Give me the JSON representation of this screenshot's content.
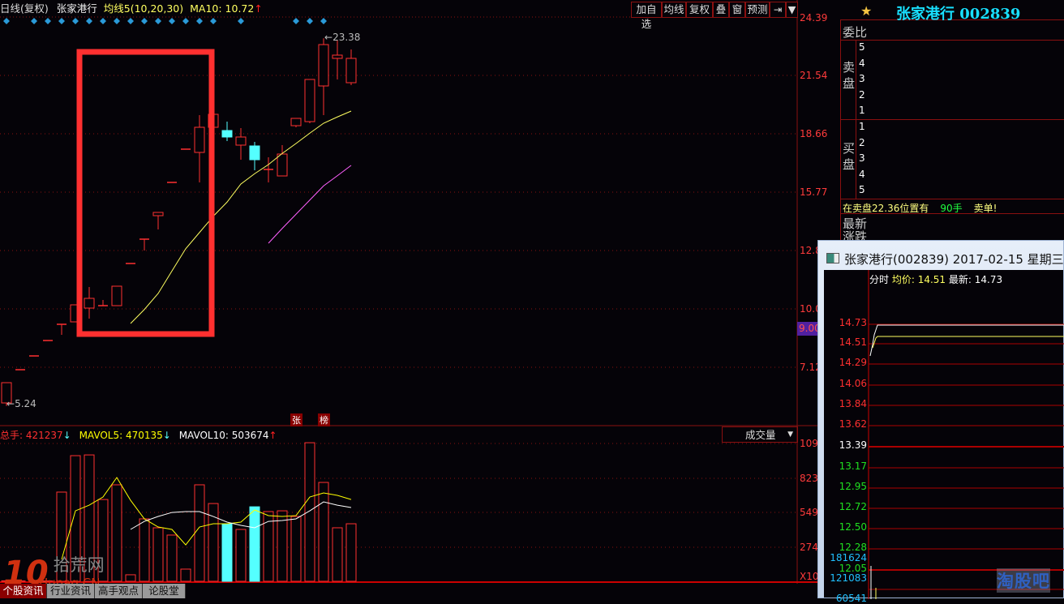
{
  "header": {
    "period": "日线(复权)",
    "stock": "张家港行",
    "ma_label": "均线5(10,20,30)",
    "ma10": "MA10: 10.72",
    "ma10_dir": "up"
  },
  "toolbar": [
    "加自选",
    "均线",
    "复权",
    "叠",
    "窗",
    "预测",
    "⇥",
    "▼"
  ],
  "colors": {
    "up": "#ff3030",
    "down": "#54ffff",
    "ma10": "#ffff60",
    "ma20": "#ff60ff",
    "mavol5": "#ffff00",
    "mavol10": "#ffffff",
    "grid": "#8a1010",
    "annotation": "#ff3030"
  },
  "price_axis": {
    "ticks": [
      "24.39",
      "21.54",
      "18.66",
      "15.77",
      "12.88",
      "10.00",
      "7.12"
    ],
    "current": "9.00"
  },
  "annotations": {
    "high": "23.38",
    "low": "5.24",
    "tags": [
      "张",
      "榜"
    ]
  },
  "chart_data": [
    {
      "type": "candlestick",
      "ylim": [
        4.7,
        24.39
      ],
      "candles": [
        [
          5.39,
          6.39,
          6.39,
          5.24
        ],
        [
          7.03,
          7.03,
          7.03,
          7.03
        ],
        [
          7.71,
          7.71,
          7.71,
          7.71
        ],
        [
          8.47,
          8.47,
          8.47,
          8.47
        ],
        [
          9.27,
          9.27,
          9.27,
          8.75
        ],
        [
          9.39,
          10.23,
          10.23,
          9.39
        ],
        [
          10.07,
          10.55,
          11.11,
          9.55
        ],
        [
          10.19,
          10.19,
          10.47,
          10.19
        ],
        [
          10.19,
          11.15,
          11.15,
          10.19
        ],
        [
          12.27,
          12.27,
          12.27,
          12.27
        ],
        [
          13.47,
          13.47,
          13.47,
          12.91
        ],
        [
          14.63,
          14.79,
          14.79,
          13.95
        ],
        [
          16.27,
          16.27,
          16.27,
          16.27
        ],
        [
          17.91,
          17.91,
          17.91,
          17.91
        ],
        [
          17.75,
          18.99,
          19.59,
          16.27
        ],
        [
          18.99,
          19.63,
          19.63,
          18.99
        ],
        [
          18.83,
          18.51,
          19.27,
          18.31
        ],
        [
          18.11,
          18.51,
          18.95,
          17.39
        ],
        [
          18.07,
          17.39,
          18.27,
          16.87
        ],
        [
          16.91,
          16.91,
          17.51,
          16.27
        ],
        [
          16.59,
          17.67,
          18.11,
          16.59
        ],
        [
          19.07,
          19.43,
          19.43,
          18.99
        ],
        [
          19.27,
          21.35,
          21.35,
          19.19
        ],
        [
          21.03,
          23.07,
          23.38,
          19.59
        ],
        [
          22.39,
          22.55,
          23.27,
          21.35
        ],
        [
          21.19,
          22.39,
          22.83,
          21.07
        ]
      ],
      "candle_fields": [
        "open",
        "close",
        "high",
        "low"
      ],
      "markers": [
        1,
        0,
        1,
        1,
        1,
        1,
        1,
        1,
        1,
        1,
        1,
        1,
        1,
        1,
        1,
        1,
        0,
        1,
        0,
        0,
        0,
        1,
        1,
        1,
        0,
        0
      ],
      "ma10": [
        null,
        null,
        null,
        null,
        null,
        null,
        null,
        null,
        null,
        9.31,
        10.0,
        10.79,
        11.9,
        13.0,
        13.8,
        14.6,
        15.3,
        16.19,
        16.7,
        17.15,
        17.7,
        18.19,
        18.7,
        19.19,
        19.5,
        19.79
      ],
      "ma20": [
        null,
        null,
        null,
        null,
        null,
        null,
        null,
        null,
        null,
        null,
        null,
        null,
        null,
        null,
        null,
        null,
        null,
        null,
        null,
        13.27,
        14.0,
        14.7,
        15.4,
        16.1,
        16.6,
        17.11
      ]
    },
    {
      "type": "bar",
      "ylim": [
        0,
        1097
      ],
      "ticks": [
        "109",
        "823",
        "549",
        "274",
        "X10"
      ],
      "volume": [
        4,
        3,
        3,
        3,
        710,
        1000,
        1006,
        651,
        768,
        52,
        497,
        426,
        368,
        97,
        768,
        619,
        458,
        413,
        593,
        555,
        561,
        516,
        1103,
        787,
        426,
        458
      ],
      "mavol5": [
        null,
        null,
        null,
        null,
        174,
        561,
        606,
        671,
        826,
        645,
        497,
        432,
        413,
        290,
        432,
        458,
        458,
        471,
        568,
        523,
        516,
        523,
        671,
        703,
        684,
        651
      ],
      "mavol10": [
        null,
        null,
        null,
        null,
        null,
        null,
        null,
        null,
        null,
        413,
        477,
        516,
        548,
        555,
        555,
        516,
        471,
        445,
        426,
        477,
        484,
        497,
        561,
        632,
        606,
        587
      ]
    }
  ],
  "volume_header": {
    "total": "总手: 421237",
    "mavol5": "MAVOL5: 470135",
    "mavol10": "MAVOL10: 503674",
    "selector": "成交量"
  },
  "right_panel": {
    "title": "张家港行 002839",
    "weibi": "委比",
    "sell_label": "卖盘",
    "buy_label": "买盘",
    "sell_levels": [
      "5",
      "4",
      "3",
      "2",
      "1"
    ],
    "buy_levels": [
      "1",
      "2",
      "3",
      "4",
      "5"
    ],
    "msg_a": "在卖盘22.36位置有",
    "msg_b": "90手",
    "msg_c": "卖单!",
    "latest": "最新",
    "change": "涨跌"
  },
  "popup": {
    "title": "张家港行(002839) 2017-02-15 星期三",
    "header_a": "分时",
    "header_b": "均价: 14.51",
    "header_c": "最新: 14.73",
    "price_ticks": [
      "14.73",
      "14.51",
      "14.29",
      "14.06",
      "13.84",
      "13.62",
      "13.39",
      "13.17",
      "12.95",
      "12.72",
      "12.50",
      "12.28",
      "12.05"
    ],
    "vol_ticks": [
      "181624",
      "121083",
      "60541"
    ]
  },
  "tabs": [
    "个股资讯",
    "行业资讯",
    "高手观点",
    "论股堂"
  ],
  "watermarks": [
    "10 Hunag.CN 拾荒网",
    "淘股吧"
  ]
}
